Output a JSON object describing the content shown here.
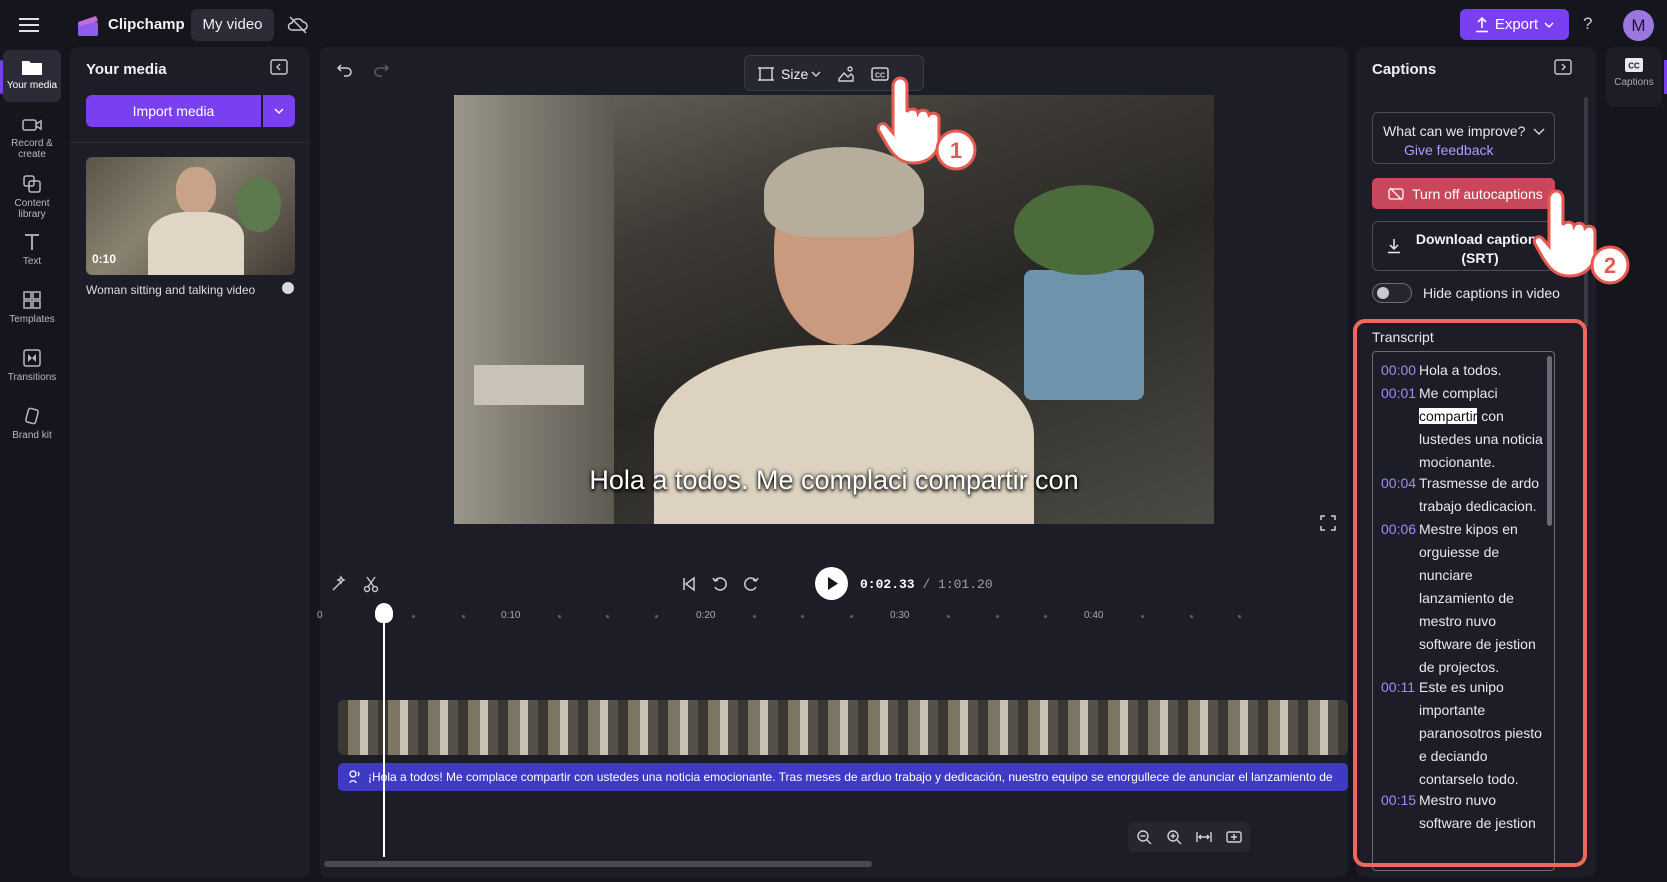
{
  "app": {
    "name": "Clipchamp",
    "video_tab": "My video",
    "export_label": "Export",
    "help": "?",
    "avatar_initial": "M"
  },
  "rail": {
    "items": [
      {
        "label": "Your media",
        "icon": "folder-icon"
      },
      {
        "label": "Record & create",
        "icon": "camera-icon"
      },
      {
        "label": "Content library",
        "icon": "library-icon"
      },
      {
        "label": "Text",
        "icon": "text-icon"
      },
      {
        "label": "Templates",
        "icon": "templates-icon"
      },
      {
        "label": "Transitions",
        "icon": "transitions-icon"
      },
      {
        "label": "Brand kit",
        "icon": "brand-kit-icon"
      }
    ]
  },
  "media": {
    "title": "Your media",
    "import_label": "Import media",
    "item": {
      "duration": "0:10",
      "name": "Woman sitting and talking video"
    }
  },
  "preview": {
    "size_label": "Size",
    "caption_overlay": "Hola a todos. Me complaci compartir con"
  },
  "playback": {
    "current": "0:02.33",
    "total": "/ 1:01.20"
  },
  "timeline": {
    "ticks": [
      "0",
      "0:10",
      "0:20",
      "0:30",
      "0:40"
    ],
    "caption_track": "¡Hola a todos! Me complace compartir con ustedes una noticia emocionante. Tras meses de arduo trabajo y dedicación, nuestro equipo se enorgullece de anunciar el lanzamiento de"
  },
  "captions": {
    "title": "Captions",
    "feedback_question": "What can we improve?",
    "feedback_link": "Give feedback",
    "turn_off_label": "Turn off autocaptions",
    "download_label": "Download captions (SRT)",
    "hide_label": "Hide captions in video",
    "transcript_label": "Transcript",
    "transcript": [
      {
        "time": "00:00",
        "text": "Hola a todos."
      },
      {
        "time": "00:01",
        "text": "Me complaci compartir con lustedes una noticia mocionante."
      },
      {
        "time": "00:04",
        "text": "Trasmesse de ardo trabajo dedicacion."
      },
      {
        "time": "00:06",
        "text": "Mestre kipos en orguiesse de nunciare lanzamiento de mestro nuvo software de jestion de projectos."
      },
      {
        "time": "00:11",
        "text": "Este es unipo importante paranosotros piesto e deciando contarselo todo."
      },
      {
        "time": "00:15",
        "text": "Mestro nuvo software de jestion"
      }
    ],
    "highlighted_word": "compartir"
  },
  "right_rail": {
    "label": "Captions"
  },
  "tutorial": {
    "step1": "1",
    "step2": "2"
  },
  "colors": {
    "accent": "#7b3ff2",
    "danger": "#c8475a",
    "highlight": "#f0685b",
    "timestamp": "#a389f4"
  }
}
